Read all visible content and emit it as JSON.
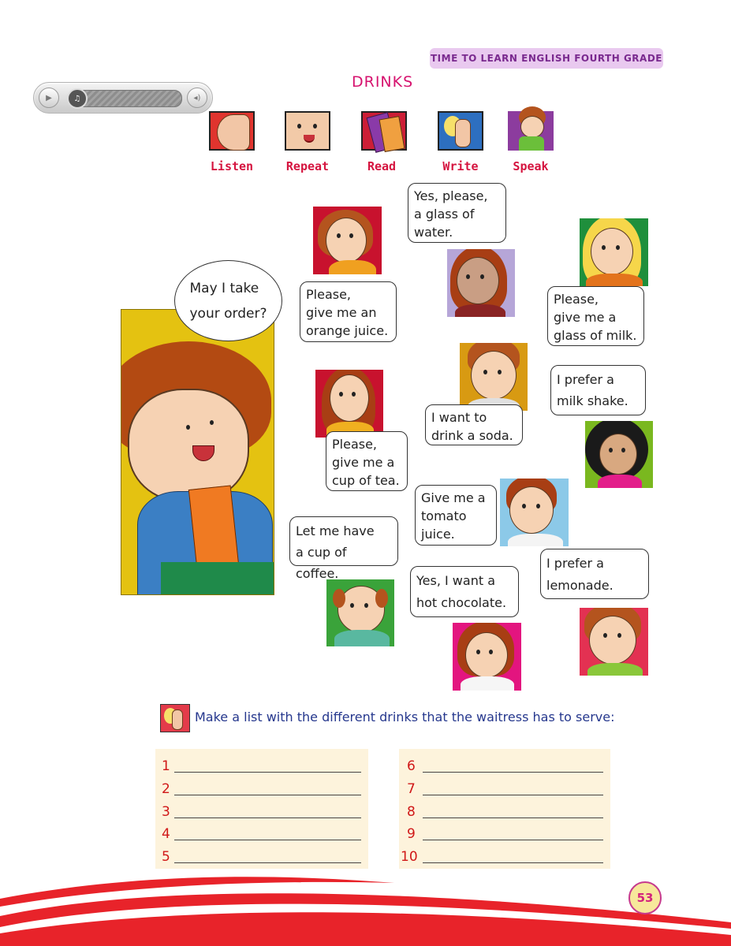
{
  "header": {
    "book_title": "TIME TO LEARN ENGLISH FOURTH GRADE"
  },
  "page": {
    "title": "DRINKS",
    "number": "53"
  },
  "audio_player": {
    "progress": 0.0
  },
  "activities": [
    "Listen",
    "Repeat",
    "Read",
    "Write",
    "Speak"
  ],
  "dialogue": {
    "waiter": "May I take\nyour order?",
    "orange_juice": "Please,\ngive me an\norange juice.",
    "water": "Yes, please,\na glass of\nwater.",
    "milk": "Please,\ngive me a\nglass of milk.",
    "soda": "I want to\ndrink a soda.",
    "milk_shake": "I prefer a\nmilk shake.",
    "tea": "Please,\ngive me a\ncup of tea.",
    "tomato_juice": "Give me a\ntomato\njuice.",
    "coffee": "Let me have\na cup of coffee.",
    "hot_chocolate": "Yes, I want a\nhot chocolate.",
    "lemonade": "I prefer a\nlemonade."
  },
  "instruction": "Make a list with the different drinks that the waitress has to serve:",
  "list_left": [
    "1",
    "2",
    "3",
    "4",
    "5"
  ],
  "list_right": [
    "6",
    "7",
    "8",
    "9",
    "10"
  ],
  "colors": {
    "accent": "#d6126e",
    "label_red": "#d5143f",
    "instruction_blue": "#25378d",
    "footer_red": "#e8232a"
  }
}
